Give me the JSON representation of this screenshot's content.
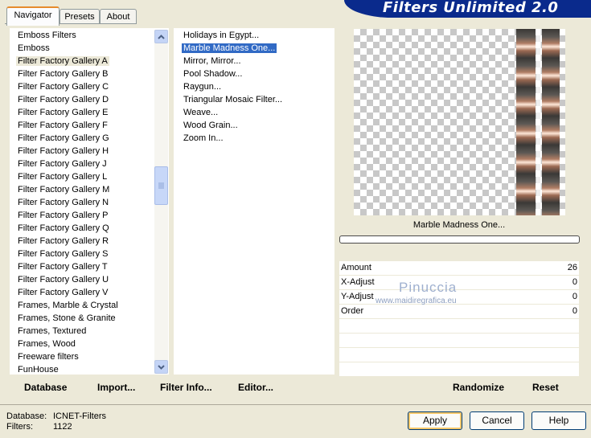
{
  "tabs": [
    "Navigator",
    "Presets",
    "About"
  ],
  "banner_title": "Filters Unlimited 2.0",
  "categories": [
    "Emboss Filters",
    "Emboss",
    "Filter Factory Gallery A",
    "Filter Factory Gallery B",
    "Filter Factory Gallery C",
    "Filter Factory Gallery D",
    "Filter Factory Gallery E",
    "Filter Factory Gallery F",
    "Filter Factory Gallery G",
    "Filter Factory Gallery H",
    "Filter Factory Gallery J",
    "Filter Factory Gallery L",
    "Filter Factory Gallery M",
    "Filter Factory Gallery N",
    "Filter Factory Gallery P",
    "Filter Factory Gallery Q",
    "Filter Factory Gallery R",
    "Filter Factory Gallery S",
    "Filter Factory Gallery T",
    "Filter Factory Gallery U",
    "Filter Factory Gallery V",
    "Frames, Marble & Crystal",
    "Frames, Stone & Granite",
    "Frames, Textured",
    "Frames, Wood",
    "Freeware filters",
    "FunHouse"
  ],
  "selected_category": "Filter Factory Gallery A",
  "filters": [
    "Holidays in Egypt...",
    "Marble Madness One...",
    "Mirror, Mirror...",
    "Pool Shadow...",
    "Raygun...",
    "Triangular Mosaic Filter...",
    "Weave...",
    "Wood Grain...",
    "Zoom In..."
  ],
  "selected_filter": "Marble Madness One...",
  "actions": {
    "database": "Database",
    "import": "Import...",
    "filter_info": "Filter Info...",
    "editor": "Editor..."
  },
  "preview_filter_name": "Marble Madness One...",
  "params": [
    {
      "name": "Amount",
      "value": "26"
    },
    {
      "name": "X-Adjust",
      "value": "0"
    },
    {
      "name": "Y-Adjust",
      "value": "0"
    },
    {
      "name": "Order",
      "value": "0"
    }
  ],
  "watermark": {
    "name": "Pinuccia",
    "site": "www.maidiregrafica.eu"
  },
  "randomize_label": "Randomize",
  "reset_label": "Reset",
  "status": {
    "database_label": "Database:",
    "database_value": "ICNET-Filters",
    "filters_label": "Filters:",
    "filters_value": "1122"
  },
  "buttons": {
    "apply": "Apply",
    "cancel": "Cancel",
    "help": "Help"
  }
}
